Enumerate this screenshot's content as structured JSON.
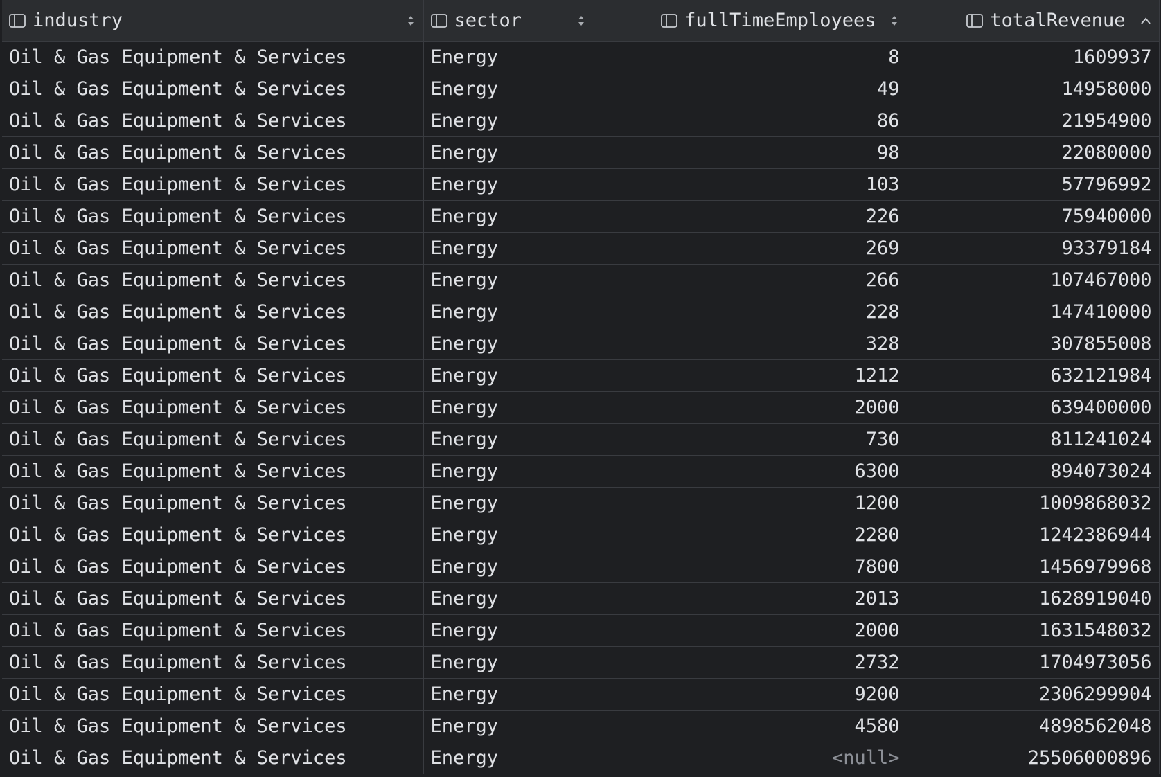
{
  "columns": [
    {
      "key": "industry",
      "label": "industry",
      "icon": "column-icon",
      "sort": "sortable-arrows-icon"
    },
    {
      "key": "sector",
      "label": "sector",
      "icon": "column-icon",
      "sort": "sortable-arrows-icon"
    },
    {
      "key": "fullTimeEmployees",
      "label": "fullTimeEmployees",
      "icon": "column-icon",
      "sort": "sortable-arrows-icon"
    },
    {
      "key": "totalRevenue",
      "label": "totalRevenue",
      "icon": "column-icon",
      "sort": "sort-ascending-icon"
    }
  ],
  "rows": [
    {
      "industry": "Oil & Gas Equipment & Services",
      "sector": "Energy",
      "fullTimeEmployees": "8",
      "totalRevenue": "1609937"
    },
    {
      "industry": "Oil & Gas Equipment & Services",
      "sector": "Energy",
      "fullTimeEmployees": "49",
      "totalRevenue": "14958000"
    },
    {
      "industry": "Oil & Gas Equipment & Services",
      "sector": "Energy",
      "fullTimeEmployees": "86",
      "totalRevenue": "21954900"
    },
    {
      "industry": "Oil & Gas Equipment & Services",
      "sector": "Energy",
      "fullTimeEmployees": "98",
      "totalRevenue": "22080000"
    },
    {
      "industry": "Oil & Gas Equipment & Services",
      "sector": "Energy",
      "fullTimeEmployees": "103",
      "totalRevenue": "57796992"
    },
    {
      "industry": "Oil & Gas Equipment & Services",
      "sector": "Energy",
      "fullTimeEmployees": "226",
      "totalRevenue": "75940000"
    },
    {
      "industry": "Oil & Gas Equipment & Services",
      "sector": "Energy",
      "fullTimeEmployees": "269",
      "totalRevenue": "93379184"
    },
    {
      "industry": "Oil & Gas Equipment & Services",
      "sector": "Energy",
      "fullTimeEmployees": "266",
      "totalRevenue": "107467000"
    },
    {
      "industry": "Oil & Gas Equipment & Services",
      "sector": "Energy",
      "fullTimeEmployees": "228",
      "totalRevenue": "147410000"
    },
    {
      "industry": "Oil & Gas Equipment & Services",
      "sector": "Energy",
      "fullTimeEmployees": "328",
      "totalRevenue": "307855008"
    },
    {
      "industry": "Oil & Gas Equipment & Services",
      "sector": "Energy",
      "fullTimeEmployees": "1212",
      "totalRevenue": "632121984"
    },
    {
      "industry": "Oil & Gas Equipment & Services",
      "sector": "Energy",
      "fullTimeEmployees": "2000",
      "totalRevenue": "639400000"
    },
    {
      "industry": "Oil & Gas Equipment & Services",
      "sector": "Energy",
      "fullTimeEmployees": "730",
      "totalRevenue": "811241024"
    },
    {
      "industry": "Oil & Gas Equipment & Services",
      "sector": "Energy",
      "fullTimeEmployees": "6300",
      "totalRevenue": "894073024"
    },
    {
      "industry": "Oil & Gas Equipment & Services",
      "sector": "Energy",
      "fullTimeEmployees": "1200",
      "totalRevenue": "1009868032"
    },
    {
      "industry": "Oil & Gas Equipment & Services",
      "sector": "Energy",
      "fullTimeEmployees": "2280",
      "totalRevenue": "1242386944"
    },
    {
      "industry": "Oil & Gas Equipment & Services",
      "sector": "Energy",
      "fullTimeEmployees": "7800",
      "totalRevenue": "1456979968"
    },
    {
      "industry": "Oil & Gas Equipment & Services",
      "sector": "Energy",
      "fullTimeEmployees": "2013",
      "totalRevenue": "1628919040"
    },
    {
      "industry": "Oil & Gas Equipment & Services",
      "sector": "Energy",
      "fullTimeEmployees": "2000",
      "totalRevenue": "1631548032"
    },
    {
      "industry": "Oil & Gas Equipment & Services",
      "sector": "Energy",
      "fullTimeEmployees": "2732",
      "totalRevenue": "1704973056"
    },
    {
      "industry": "Oil & Gas Equipment & Services",
      "sector": "Energy",
      "fullTimeEmployees": "9200",
      "totalRevenue": "2306299904"
    },
    {
      "industry": "Oil & Gas Equipment & Services",
      "sector": "Energy",
      "fullTimeEmployees": "4580",
      "totalRevenue": "4898562048"
    },
    {
      "industry": "Oil & Gas Equipment & Services",
      "sector": "Energy",
      "fullTimeEmployees": "<null>",
      "totalRevenue": "25506000896"
    }
  ],
  "colors": {
    "background": "#1e1f22",
    "header_background": "#2b2d30",
    "grid_line": "#393b40",
    "text": "#dfe1e5",
    "null_text": "#8c8f96"
  }
}
